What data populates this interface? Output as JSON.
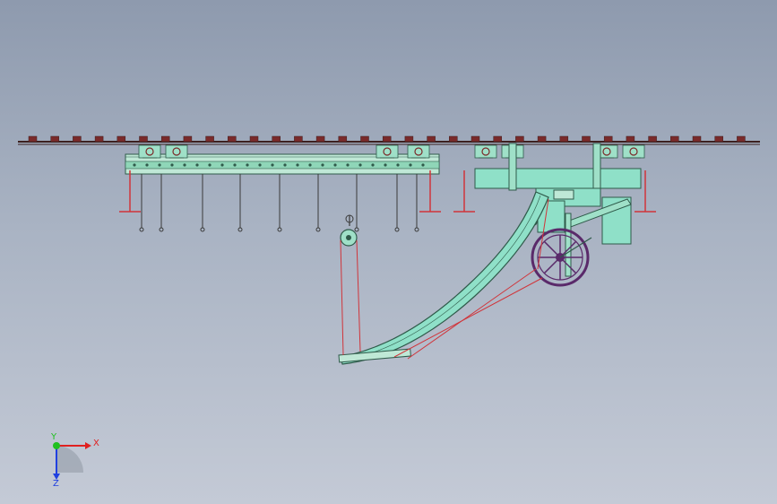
{
  "viewport": {
    "background_top": "#8e9aae",
    "background_bottom": "#c4cad6"
  },
  "colors": {
    "rail": "#3c2020",
    "rail_block": "#7a2a2a",
    "carriage": "#9fe0c8",
    "carriage_dark": "#2f5a4a",
    "cable": "#d0343a",
    "machine": "#8fe0c8",
    "wheel": "#5a2a6a",
    "hanger": "#3a3a3a"
  },
  "triad": {
    "x_label": "X",
    "y_label": "Y",
    "z_label": "Z",
    "x_color": "#e02020",
    "y_color": "#20c020",
    "z_color": "#2040e0"
  }
}
